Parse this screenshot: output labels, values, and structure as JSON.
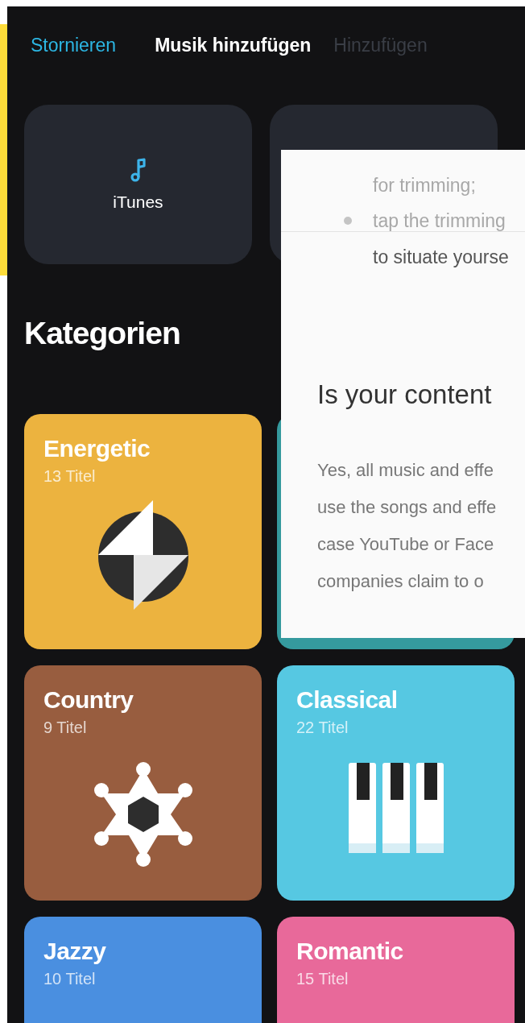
{
  "header": {
    "cancel": "Stornieren",
    "title": "Musik hinzufügen",
    "add": {
      "label": "Hinzufügen",
      "disabled": true
    }
  },
  "sources": [
    {
      "label": "iTunes",
      "kind": "itunes"
    },
    {
      "kind": "blank"
    }
  ],
  "section_title": "Kategorien",
  "categories": [
    {
      "title": "Energetic",
      "count": "13 Titel",
      "color": "#ecb33f",
      "kind": "bolt"
    },
    {
      "color": "#359a9e",
      "kind": "none"
    },
    {
      "title": "Country",
      "count": "9 Titel",
      "color": "#985d3f",
      "kind": "star"
    },
    {
      "title": "Classical",
      "count": "22 Titel",
      "color": "#56c8e2",
      "kind": "piano"
    },
    {
      "title": "Jazzy",
      "count": "10 Titel",
      "color": "#4a8fe0",
      "kind": "none"
    },
    {
      "title": "Romantic",
      "count": "15 Titel",
      "color": "#e8699a",
      "kind": "none"
    }
  ],
  "overlay": {
    "faded_lines": [
      {
        "text": "for trimming;",
        "bullet": false
      },
      {
        "text": "tap the trimming",
        "bullet": true
      }
    ],
    "line": "to situate yourse",
    "heading": "Is your content",
    "paragraph_lines": [
      "Yes, all music and effe",
      "use the songs and effe",
      "case YouTube or Face",
      "companies claim to o"
    ]
  }
}
